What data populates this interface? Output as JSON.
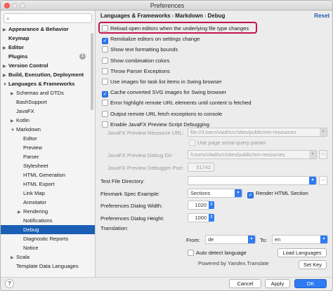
{
  "window": {
    "title": "Preferences"
  },
  "sidebar": {
    "items": [
      {
        "label": "Appearance & Behavior",
        "level": 0,
        "arrow": "▶",
        "bold": true
      },
      {
        "label": "Keymap",
        "level": 0,
        "arrow": "",
        "bold": true
      },
      {
        "label": "Editor",
        "level": 0,
        "arrow": "▶",
        "bold": true
      },
      {
        "label": "Plugins",
        "level": 0,
        "arrow": "",
        "bold": true,
        "badge": "1"
      },
      {
        "label": "Version Control",
        "level": 0,
        "arrow": "▶",
        "bold": true
      },
      {
        "label": "Build, Execution, Deployment",
        "level": 0,
        "arrow": "▶",
        "bold": true
      },
      {
        "label": "Languages & Frameworks",
        "level": 0,
        "arrow": "▼",
        "bold": true
      },
      {
        "label": "Schemas and DTDs",
        "level": 1,
        "arrow": "▶"
      },
      {
        "label": "BashSupport",
        "level": 1,
        "arrow": ""
      },
      {
        "label": "JavaFX",
        "level": 1,
        "arrow": ""
      },
      {
        "label": "Kotlin",
        "level": 1,
        "arrow": "▶"
      },
      {
        "label": "Markdown",
        "level": 1,
        "arrow": "▼"
      },
      {
        "label": "Editor",
        "level": 2,
        "arrow": ""
      },
      {
        "label": "Preview",
        "level": 2,
        "arrow": ""
      },
      {
        "label": "Parser",
        "level": 2,
        "arrow": ""
      },
      {
        "label": "Stylesheet",
        "level": 2,
        "arrow": ""
      },
      {
        "label": "HTML Generation",
        "level": 2,
        "arrow": ""
      },
      {
        "label": "HTML Export",
        "level": 2,
        "arrow": ""
      },
      {
        "label": "Link Map",
        "level": 2,
        "arrow": ""
      },
      {
        "label": "Annotator",
        "level": 2,
        "arrow": ""
      },
      {
        "label": "Rendering",
        "level": 2,
        "arrow": "▶"
      },
      {
        "label": "Notifications",
        "level": 2,
        "arrow": ""
      },
      {
        "label": "Debug",
        "level": 2,
        "arrow": "",
        "selected": true
      },
      {
        "label": "Diagnostic Reports",
        "level": 2,
        "arrow": ""
      },
      {
        "label": "Notice",
        "level": 2,
        "arrow": ""
      },
      {
        "label": "Scala",
        "level": 1,
        "arrow": "▶"
      },
      {
        "label": "Template Data Languages",
        "level": 1,
        "arrow": ""
      }
    ]
  },
  "breadcrumb": {
    "part1": "Languages & Frameworks",
    "part2": "Markdown",
    "part3": "Debug",
    "sep": "›"
  },
  "reset_label": "Reset",
  "checkboxes": [
    {
      "label": "Reload open editors when the underlying file type changes",
      "checked": false
    },
    {
      "label": "Reinitialize editors on settings change",
      "checked": true
    },
    {
      "label": "Show text formatting bounds",
      "checked": false
    },
    {
      "label": "Show combination colors",
      "checked": false
    },
    {
      "label": "Throw Parser Exceptions",
      "checked": false
    },
    {
      "label": "Use images for task list items in Swing browser",
      "checked": false
    },
    {
      "label": "Cache converted SVG images for Swing browser",
      "checked": true
    },
    {
      "label": "Error highlight remote URL elements until content is fetched",
      "checked": false
    },
    {
      "label": "Output remote URL fetch exceptions to console",
      "checked": false
    },
    {
      "label": "Enable JavaFX Preview Script Debugging",
      "checked": false
    }
  ],
  "javafx": {
    "resource_url_label": "JavaFX Preview Resource URL:",
    "resource_url_value": "file:///Users/vlad/src/sites/public/mn-resources",
    "serial_query_label": "Use page serial query param",
    "debug_dir_label": "JavaFX Preview Debug Dir:",
    "debug_dir_value": "/Users/vlad/src/sites/public/mn-resources",
    "port_label": "JavaFX Preview Debugger Port:",
    "port_value": "51742"
  },
  "test_file_label": "Test File Directory:",
  "flexmark": {
    "label": "Flexmark Spec Example:",
    "value": "Sections",
    "render_label": "Render HTML Section",
    "render_checked": true
  },
  "dialog_width": {
    "label": "Preferences Dialog Width:",
    "value": "1020"
  },
  "dialog_height": {
    "label": "Preferences Dialog Height:",
    "value": "1000"
  },
  "translation": {
    "label": "Translation:",
    "from_label": "From:",
    "from_value": "de",
    "to_label": "To:",
    "to_value": "en",
    "auto_detect_label": "Auto detect language",
    "load_languages": "Load Languages",
    "powered_by": "Powered by Yandex.Translate",
    "set_key": "Set Key"
  },
  "footer": {
    "help": "?",
    "cancel": "Cancel",
    "apply": "Apply",
    "ok": "OK"
  },
  "icons": {
    "search": "search-icon",
    "folder": "folder-icon",
    "dropdown": "chevron-down-icon",
    "check": "checkmark-icon"
  },
  "colors": {
    "accent": "#2f7bf2",
    "selection": "#1a5fb4",
    "highlight_box": "#c4144a",
    "link": "#1f5bb5"
  }
}
